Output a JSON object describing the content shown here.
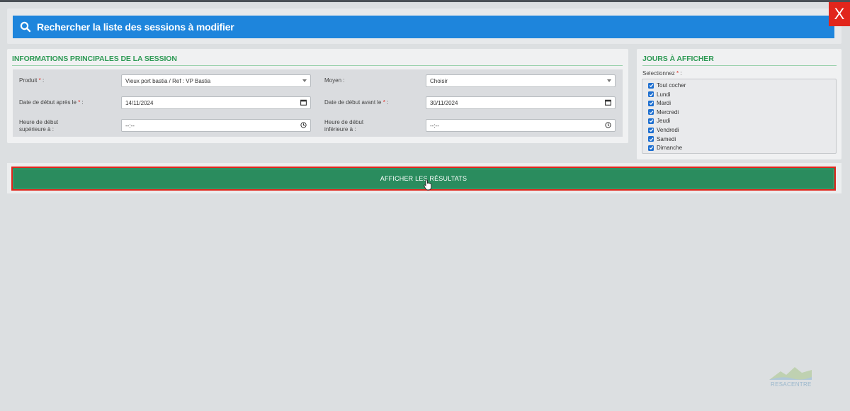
{
  "window": {
    "close_label": "X"
  },
  "search": {
    "title": "Rechercher la liste des sessions à modifier"
  },
  "main_panel": {
    "title": "INFORMATIONS PRINCIPALES DE LA SESSION",
    "produit_label": "Produit",
    "produit_value": "Vieux port bastia / Ref : VP Bastia",
    "moyen_label": "Moyen :",
    "moyen_value": "Choisir",
    "date_debut_apres_label": "Date de début après le",
    "date_debut_apres_value": "14/11/2024",
    "date_debut_avant_label": "Date de début avant le",
    "date_debut_avant_value": "30/11/2024",
    "heure_sup_label_1": "Heure de début",
    "heure_sup_label_2": "supérieure à :",
    "heure_sup_value": "--:--",
    "heure_inf_label_1": "Heure de début",
    "heure_inf_label_2": "inférieure à :",
    "heure_inf_value": "--:--",
    "required_mark": "*",
    "colon": ":"
  },
  "jours_panel": {
    "title": "JOURS À AFFICHER",
    "select_label": "Selectionnez",
    "required_mark": "*",
    "colon": ":",
    "days": [
      {
        "label": "Tout cocher",
        "checked": true
      },
      {
        "label": "Lundi",
        "checked": true
      },
      {
        "label": "Mardi",
        "checked": true
      },
      {
        "label": "Mercredi",
        "checked": true
      },
      {
        "label": "Jeudi",
        "checked": true
      },
      {
        "label": "Vendredi",
        "checked": true
      },
      {
        "label": "Samedi",
        "checked": true
      },
      {
        "label": "Dimanche",
        "checked": true
      }
    ]
  },
  "actions": {
    "show_results_label": "AFFICHER LES RÉSULTATS"
  },
  "footer_logo": {
    "text": "RESACENTRE"
  },
  "colors": {
    "accent_blue": "#1e85dc",
    "section_green": "#2e9a55",
    "button_green": "#2a8c5e",
    "close_red": "#e1261c"
  }
}
